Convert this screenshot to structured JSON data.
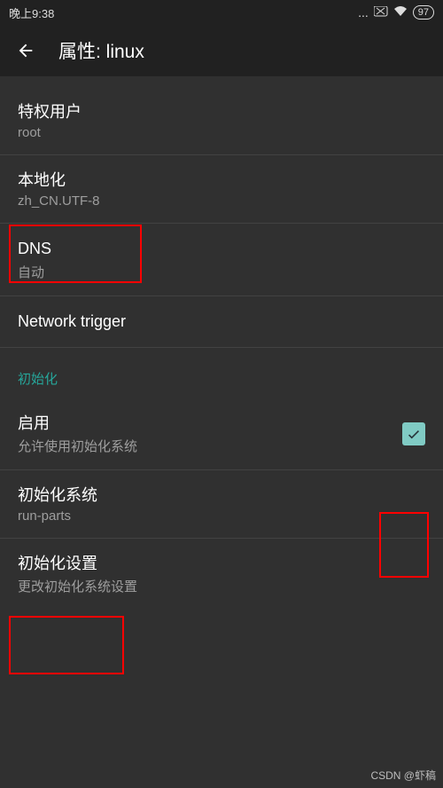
{
  "status": {
    "time": "晚上9:38",
    "battery": "97"
  },
  "header": {
    "title": "属性: linux"
  },
  "settings": {
    "privileged": {
      "title": "特权用户",
      "value": "root"
    },
    "locale": {
      "title": "本地化",
      "value": "zh_CN.UTF-8"
    },
    "dns": {
      "title": "DNS",
      "value": "自动"
    },
    "network_trigger": {
      "title": "Network trigger"
    }
  },
  "init": {
    "section_label": "初始化",
    "enable": {
      "title": "启用",
      "subtitle": "允许使用初始化系统",
      "checked": true
    },
    "system": {
      "title": "初始化系统",
      "value": "run-parts"
    },
    "settings": {
      "title": "初始化设置",
      "subtitle": "更改初始化系统设置"
    }
  },
  "watermark": "CSDN @虾稿"
}
